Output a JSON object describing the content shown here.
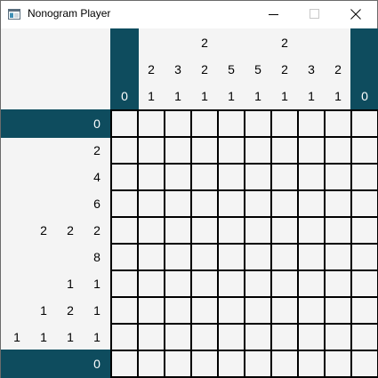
{
  "window": {
    "title": "Nonogram Player",
    "icons": {
      "app": "nonogram-app-icon",
      "minimize": "minimize-icon",
      "maximize": "maximize-icon",
      "close": "close-icon"
    }
  },
  "colors": {
    "band": "#0e4c5e",
    "board_background": "#f4f4f4",
    "grid_line": "#000000",
    "clue_text": "#000000",
    "band_text": "#ffffff"
  },
  "puzzle": {
    "columns": 10,
    "rows": 10,
    "column_clues": [
      [
        "0"
      ],
      [
        "2",
        "1"
      ],
      [
        "3",
        "1"
      ],
      [
        "2",
        "2",
        "1"
      ],
      [
        "5",
        "1"
      ],
      [
        "5",
        "1"
      ],
      [
        "2",
        "2",
        "1"
      ],
      [
        "3",
        "1"
      ],
      [
        "2",
        "1"
      ],
      [
        "0"
      ]
    ],
    "row_clues": [
      [
        "0"
      ],
      [
        "2"
      ],
      [
        "4"
      ],
      [
        "6"
      ],
      [
        "2",
        "2",
        "2"
      ],
      [
        "8"
      ],
      [
        "1",
        "1"
      ],
      [
        "1",
        "2",
        "1"
      ],
      [
        "1",
        "1",
        "1",
        "1"
      ],
      [
        "0"
      ]
    ],
    "highlighted_columns": [
      0,
      9
    ],
    "highlighted_rows": [
      0,
      9
    ]
  }
}
